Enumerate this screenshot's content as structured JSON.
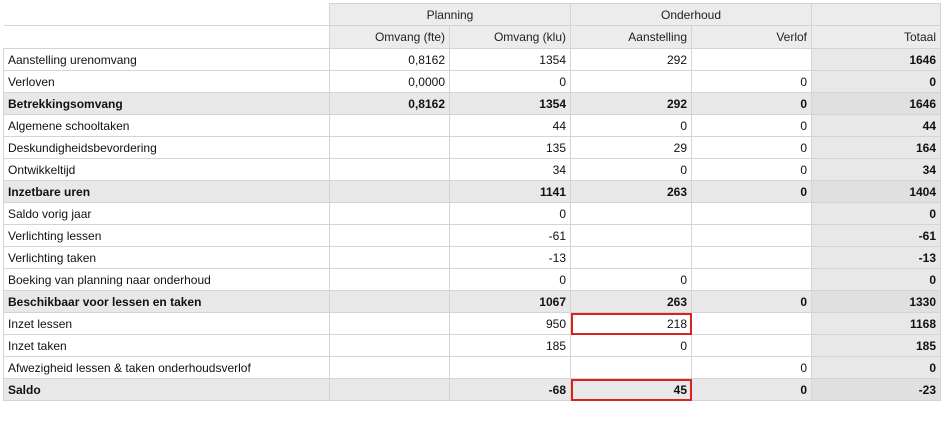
{
  "header": {
    "group_planning": "Planning",
    "group_onderhoud": "Onderhoud",
    "col_omvang_fte": "Omvang (fte)",
    "col_omvang_klu": "Omvang (klu)",
    "col_aanstelling": "Aanstelling",
    "col_verlof": "Verlof",
    "col_totaal": "Totaal"
  },
  "rows": [
    {
      "label": "Aanstelling urenomvang",
      "fte": "0,8162",
      "klu": "1354",
      "aanstelling": "292",
      "verlof": "",
      "totaal": "1646"
    },
    {
      "label": "Verloven",
      "fte": "0,0000",
      "klu": "0",
      "aanstelling": "",
      "verlof": "0",
      "totaal": "0"
    },
    {
      "label": "Betrekkingsomvang",
      "fte": "0,8162",
      "klu": "1354",
      "aanstelling": "292",
      "verlof": "0",
      "totaal": "1646"
    },
    {
      "label": "Algemene schooltaken",
      "fte": "",
      "klu": "44",
      "aanstelling": "0",
      "verlof": "0",
      "totaal": "44"
    },
    {
      "label": "Deskundigheidsbevordering",
      "fte": "",
      "klu": "135",
      "aanstelling": "29",
      "verlof": "0",
      "totaal": "164"
    },
    {
      "label": "Ontwikkeltijd",
      "fte": "",
      "klu": "34",
      "aanstelling": "0",
      "verlof": "0",
      "totaal": "34"
    },
    {
      "label": "Inzetbare uren",
      "fte": "",
      "klu": "1141",
      "aanstelling": "263",
      "verlof": "0",
      "totaal": "1404"
    },
    {
      "label": "Saldo vorig jaar",
      "fte": "",
      "klu": "0",
      "aanstelling": "",
      "verlof": "",
      "totaal": "0"
    },
    {
      "label": "Verlichting lessen",
      "fte": "",
      "klu": "-61",
      "aanstelling": "",
      "verlof": "",
      "totaal": "-61"
    },
    {
      "label": "Verlichting taken",
      "fte": "",
      "klu": "-13",
      "aanstelling": "",
      "verlof": "",
      "totaal": "-13"
    },
    {
      "label": "Boeking van planning naar onderhoud",
      "fte": "",
      "klu": "0",
      "aanstelling": "0",
      "verlof": "",
      "totaal": "0"
    },
    {
      "label": "Beschikbaar voor lessen en taken",
      "fte": "",
      "klu": "1067",
      "aanstelling": "263",
      "verlof": "0",
      "totaal": "1330"
    },
    {
      "label": "Inzet lessen",
      "fte": "",
      "klu": "950",
      "aanstelling": "218",
      "verlof": "",
      "totaal": "1168"
    },
    {
      "label": "Inzet taken",
      "fte": "",
      "klu": "185",
      "aanstelling": "0",
      "verlof": "",
      "totaal": "185"
    },
    {
      "label": "Afwezigheid lessen & taken onderhoudsverlof",
      "fte": "",
      "klu": "",
      "aanstelling": "",
      "verlof": "0",
      "totaal": "0"
    },
    {
      "label": "Saldo",
      "fte": "",
      "klu": "-68",
      "aanstelling": "45",
      "verlof": "0",
      "totaal": "-23"
    }
  ],
  "highlight_color": "#e0201b"
}
